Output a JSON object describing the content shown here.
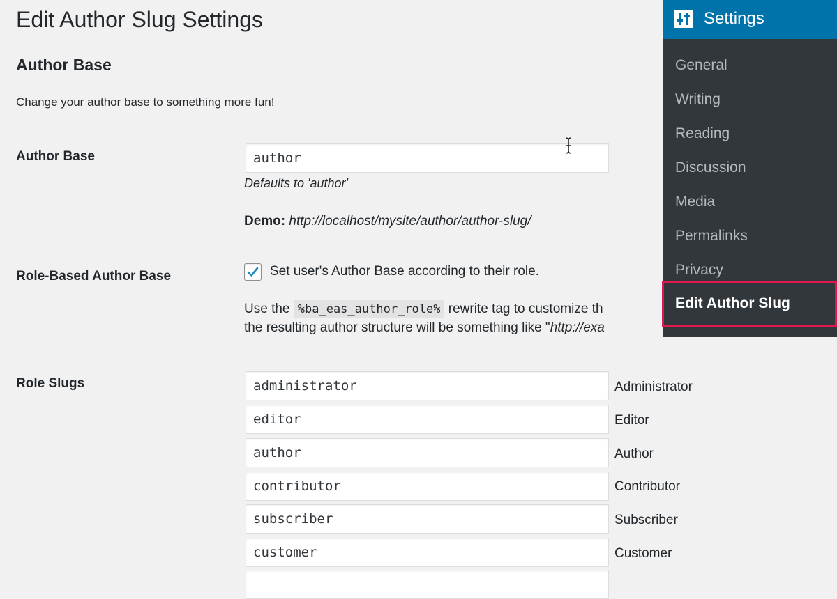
{
  "page_title": "Edit Author Slug Settings",
  "author_base_section": {
    "title": "Author Base",
    "description": "Change your author base to something more fun!"
  },
  "author_base_field": {
    "label": "Author Base",
    "value": "author",
    "hint": "Defaults to 'author'",
    "demo_label": "Demo:",
    "demo_url": "http://localhost/mysite/author/author-slug/"
  },
  "role_based": {
    "label": "Role-Based Author Base",
    "checkbox_checked": true,
    "checkbox_label": "Set user's Author Base according to their role.",
    "help_prefix": "Use the",
    "help_code": "%ba_eas_author_role%",
    "help_suffix": "rewrite tag to customize th",
    "help_line2_prefix": "the resulting author structure will be something like \"",
    "help_line2_italic": "http://exa"
  },
  "role_slugs": {
    "label": "Role Slugs",
    "items": [
      {
        "slug": "administrator",
        "role": "Administrator"
      },
      {
        "slug": "editor",
        "role": "Editor"
      },
      {
        "slug": "author",
        "role": "Author"
      },
      {
        "slug": "contributor",
        "role": "Contributor"
      },
      {
        "slug": "subscriber",
        "role": "Subscriber"
      },
      {
        "slug": "customer",
        "role": "Customer"
      }
    ]
  },
  "sidebar": {
    "header": "Settings",
    "header_icon": "settings-sliders-icon",
    "items": [
      "General",
      "Writing",
      "Reading",
      "Discussion",
      "Media",
      "Permalinks",
      "Privacy"
    ],
    "active_item": "Edit Author Slug",
    "highlight_color": "#e0184f",
    "header_color": "#0073aa"
  }
}
